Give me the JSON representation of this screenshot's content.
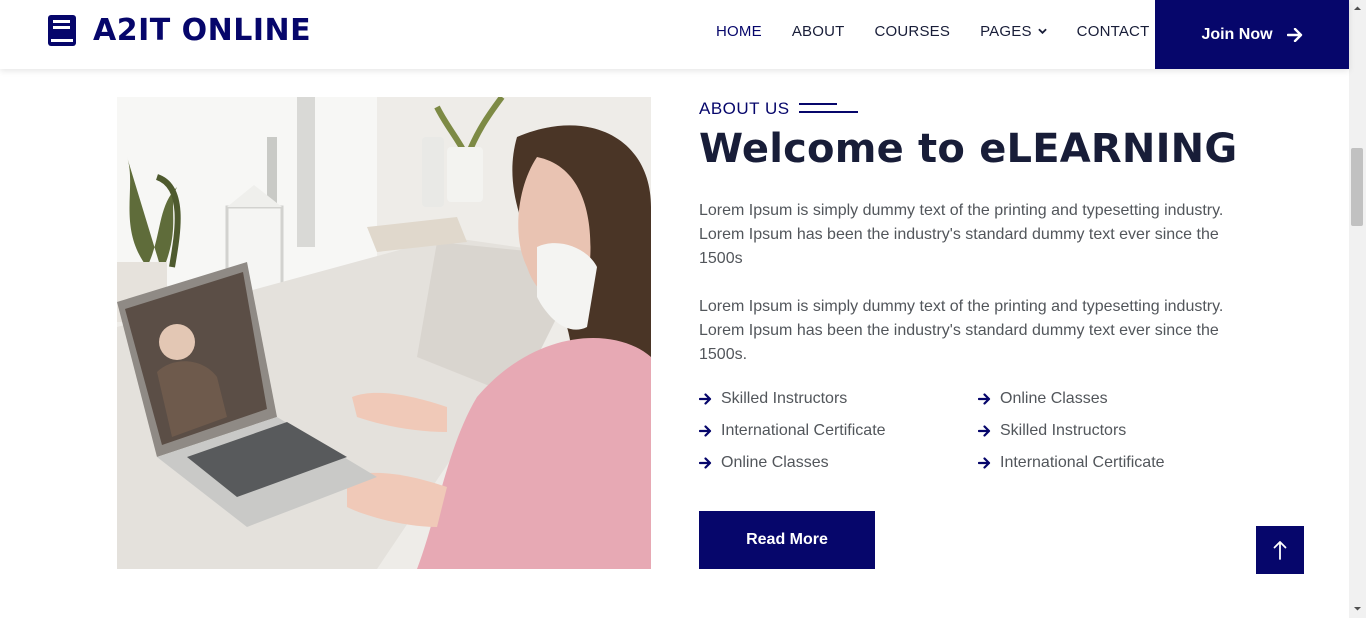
{
  "brand": {
    "name": "A2IT ONLINE",
    "icon": "book-icon"
  },
  "nav": {
    "items": [
      {
        "label": "HOME",
        "active": true
      },
      {
        "label": "ABOUT",
        "active": false
      },
      {
        "label": "COURSES",
        "active": false
      },
      {
        "label": "PAGES",
        "active": false,
        "dropdown": true
      },
      {
        "label": "CONTACT",
        "active": false
      }
    ],
    "join_label": "Join Now"
  },
  "about": {
    "section_label": "ABOUT US",
    "title": "Welcome to eLEARNING",
    "paragraphs": [
      "Lorem Ipsum is simply dummy text of the printing and typesetting industry. Lorem Ipsum has been the industry's standard dummy text ever since the 1500s",
      "Lorem Ipsum is simply dummy text of the printing and typesetting industry. Lorem Ipsum has been the industry's standard dummy text ever since the 1500s."
    ],
    "features": [
      "Skilled Instructors",
      "Online Classes",
      "International Certificate",
      "Skilled Instructors",
      "Online Classes",
      "International Certificate"
    ],
    "read_more_label": "Read More"
  },
  "colors": {
    "primary": "#06066b",
    "heading": "#181d38",
    "text": "#52565b"
  },
  "back_to_top_icon": "arrow-up-icon"
}
